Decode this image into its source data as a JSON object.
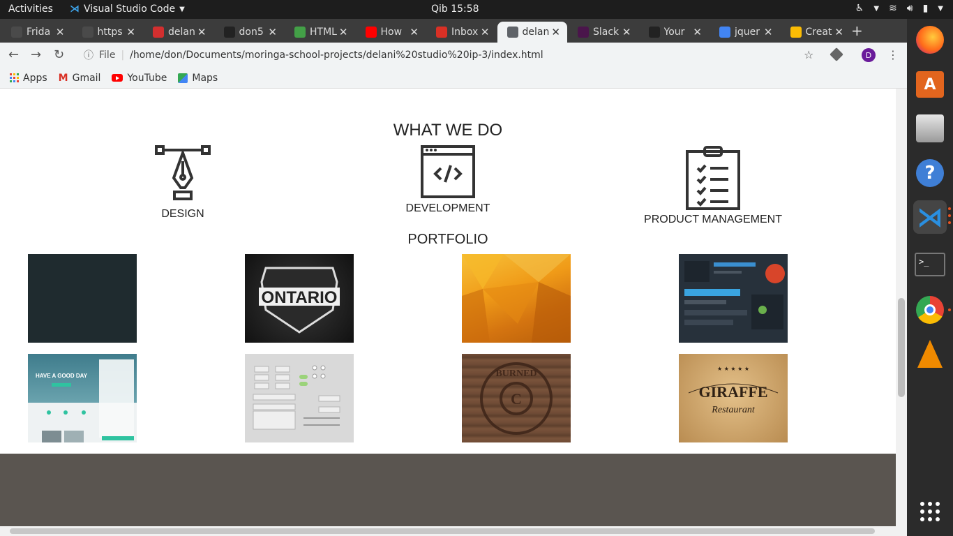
{
  "topbar": {
    "activities": "Activities",
    "app_name": "Visual Studio Code",
    "clock": "Qib 15:58"
  },
  "tabs": [
    {
      "title": "Frida",
      "favicon_color": "#4a4a4a"
    },
    {
      "title": "https",
      "favicon_color": "#4a4a4a"
    },
    {
      "title": "delan",
      "favicon_color": "#d32f2f"
    },
    {
      "title": "don5",
      "favicon_color": "#222222"
    },
    {
      "title": "HTML",
      "favicon_color": "#43a047"
    },
    {
      "title": "How",
      "favicon_color": "#ff0000"
    },
    {
      "title": "Inbox",
      "favicon_color": "#d93025"
    },
    {
      "title": "delan",
      "favicon_color": "#5f6368"
    },
    {
      "title": "Slack",
      "favicon_color": "#4a154b"
    },
    {
      "title": "Your",
      "favicon_color": "#222222"
    },
    {
      "title": "jquer",
      "favicon_color": "#4285f4"
    },
    {
      "title": "Creat",
      "favicon_color": "#fbbc04"
    }
  ],
  "active_tab_index": 7,
  "toolbar": {
    "file_label": "File",
    "url": "/home/don/Documents/moringa-school-projects/delani%20studio%20ip-3/index.html",
    "profile_initial": "D"
  },
  "bookmarks": [
    {
      "label": "Apps",
      "icon": "apps-grid-icon"
    },
    {
      "label": "Gmail",
      "icon": "gmail-icon"
    },
    {
      "label": "YouTube",
      "icon": "youtube-icon"
    },
    {
      "label": "Maps",
      "icon": "maps-icon"
    }
  ],
  "page": {
    "what_we_do_title": "WHAT WE DO",
    "services": [
      {
        "label": "DESIGN",
        "icon": "pen-tool-icon"
      },
      {
        "label": "DEVELOPMENT",
        "icon": "code-window-icon"
      },
      {
        "label": "PRODUCT MANAGEMENT",
        "icon": "clipboard-checklist-icon"
      }
    ],
    "portfolio_title": "PORTFOLIO",
    "portfolio": [
      {
        "name": "work-dark-slate",
        "colors": [
          "#1f2b2f",
          "#1f2b2f"
        ]
      },
      {
        "name": "work-mighty-ontario",
        "text": "ONTARIO",
        "colors": [
          "#1a1a1a",
          "#3a3a3a"
        ]
      },
      {
        "name": "work-orange-polygon",
        "colors": [
          "#f3a417",
          "#c86a0a"
        ]
      },
      {
        "name": "work-dark-dashboard",
        "colors": [
          "#2b3540",
          "#1a2129"
        ]
      },
      {
        "name": "work-have-a-good-day",
        "text": "HAVE A GOOD DAY",
        "colors": [
          "#3d7a8a",
          "#e8eef0"
        ]
      },
      {
        "name": "work-ui-kit",
        "colors": [
          "#d9d9d9",
          "#cfcfcf"
        ]
      },
      {
        "name": "work-burned-logo",
        "text": "BURNED",
        "colors": [
          "#6d4a35",
          "#3f2a1e"
        ]
      },
      {
        "name": "work-giraffe-restaurant",
        "text": "GIRAFFE",
        "colors": [
          "#d8b27a",
          "#b88a4f"
        ]
      }
    ]
  },
  "colors": {
    "chrome_dark": "#3c3c3c",
    "toolbar_bg": "#f1f3f4",
    "footer_band": "#5a5550",
    "dock_bg": "#2b2b2b"
  }
}
